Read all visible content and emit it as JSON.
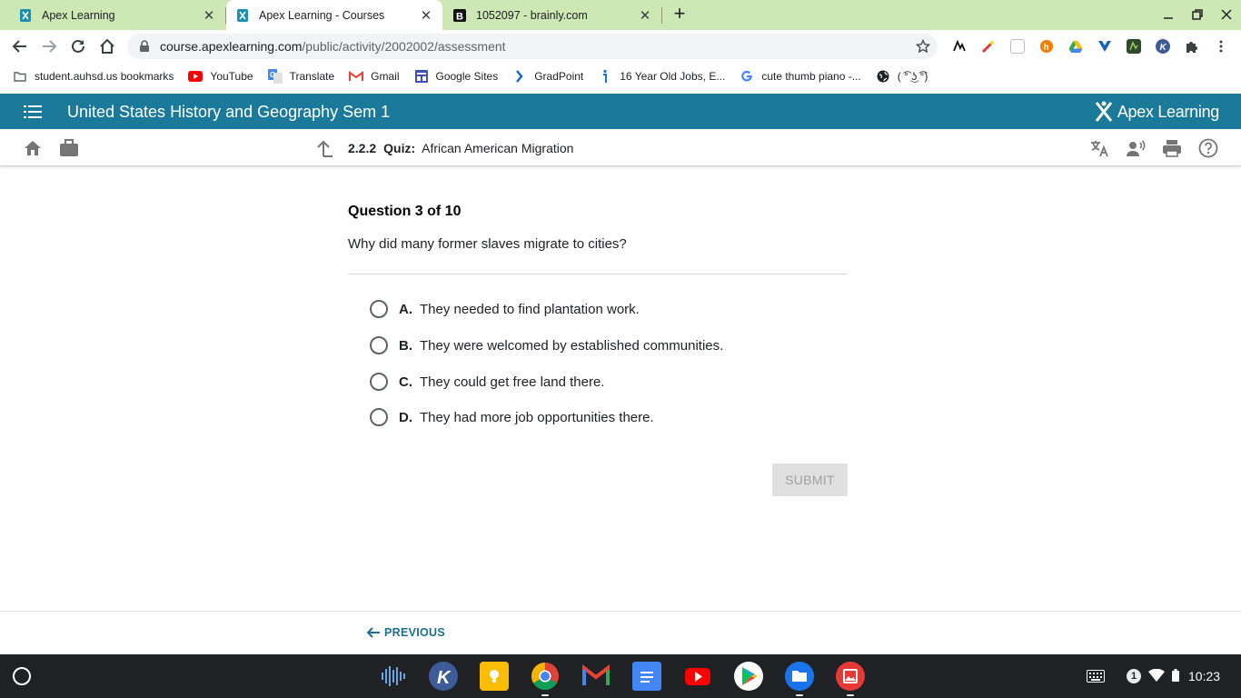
{
  "browser": {
    "tabs": [
      {
        "title": "Apex Learning",
        "active": false
      },
      {
        "title": "Apex Learning - Courses",
        "active": true
      },
      {
        "title": "1052097 - brainly.com",
        "active": false
      }
    ],
    "url_host": "course.apexlearning.com",
    "url_path": "/public/activity/2002002/assessment",
    "bookmarks": [
      {
        "label": "student.auhsd.us bookmarks",
        "icon": "folder-icon"
      },
      {
        "label": "YouTube",
        "icon": "youtube-icon"
      },
      {
        "label": "Translate",
        "icon": "translate-icon"
      },
      {
        "label": "Gmail",
        "icon": "gmail-icon"
      },
      {
        "label": "Google Sites",
        "icon": "google-sites-icon"
      },
      {
        "label": "GradPoint",
        "icon": "gradpoint-icon"
      },
      {
        "label": "16 Year Old Jobs, E...",
        "icon": "info-icon"
      },
      {
        "label": "cute thumb piano -...",
        "icon": "google-icon"
      },
      {
        "label": "( ͡° ͜ʖ ͡°)",
        "icon": "globe-icon"
      }
    ]
  },
  "apex": {
    "course_title": "United States History and Geography Sem 1",
    "logo_text": "Apex Learning",
    "activity_number": "2.2.2",
    "activity_kind": "Quiz:",
    "activity_title": "African American Migration",
    "colors": {
      "header": "#1b7a99",
      "link": "#1b6f92"
    }
  },
  "question": {
    "header": "Question 3 of 10",
    "prompt": "Why did many former slaves migrate to cities?",
    "choices": [
      {
        "letter": "A.",
        "text": "They needed to find plantation work."
      },
      {
        "letter": "B.",
        "text": "They were welcomed by established communities."
      },
      {
        "letter": "C.",
        "text": "They could get free land there."
      },
      {
        "letter": "D.",
        "text": "They had more job opportunities there."
      }
    ],
    "submit_label": "SUBMIT"
  },
  "footer": {
    "previous_label": "PREVIOUS"
  },
  "shelf": {
    "notification_count": "1",
    "time": "10:23"
  }
}
